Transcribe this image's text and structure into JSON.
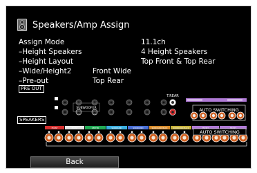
{
  "header": {
    "title": "Speakers/Amp Assign"
  },
  "settings": [
    {
      "label": "Assign Mode",
      "value": "11.1ch"
    },
    {
      "label": "–Height Speakers",
      "value": "4 Height Speakers"
    },
    {
      "label": "–Height Layout",
      "value": "Top Front & Top Rear"
    },
    {
      "label": "–Wide/Height2",
      "value": "Front Wide"
    },
    {
      "label": "–Pre-out",
      "value": "Top Rear"
    }
  ],
  "panel": {
    "preout_label": "PRE OUT",
    "speakers_label": "SPEAKERS",
    "subwoofer_label": "SUBWOOFER",
    "trear_label": "T.REAR",
    "auto_switching_top": "AUTO SWITCHING",
    "auto_switching_bottom": "AUTO SWITCHING",
    "channel_tags": [
      "FRONT",
      "FRONT",
      "CENTER",
      "SURROUND",
      "SURROUND",
      "SURROUND BACK",
      "SURROUND BACK",
      "FRONT",
      "FRONT"
    ],
    "colors": {
      "front_left": "#e8e8e8",
      "front_right": "#d63030",
      "center": "#22aa55",
      "surround_left": "#3aaee0",
      "surround_right": "#4a6fd6",
      "surr_back_l": "#d98c2a",
      "surr_back_r": "#c8b23a",
      "height": "#b07ad6",
      "jack": "#d06020"
    }
  },
  "footer": {
    "back_label": "Back"
  }
}
